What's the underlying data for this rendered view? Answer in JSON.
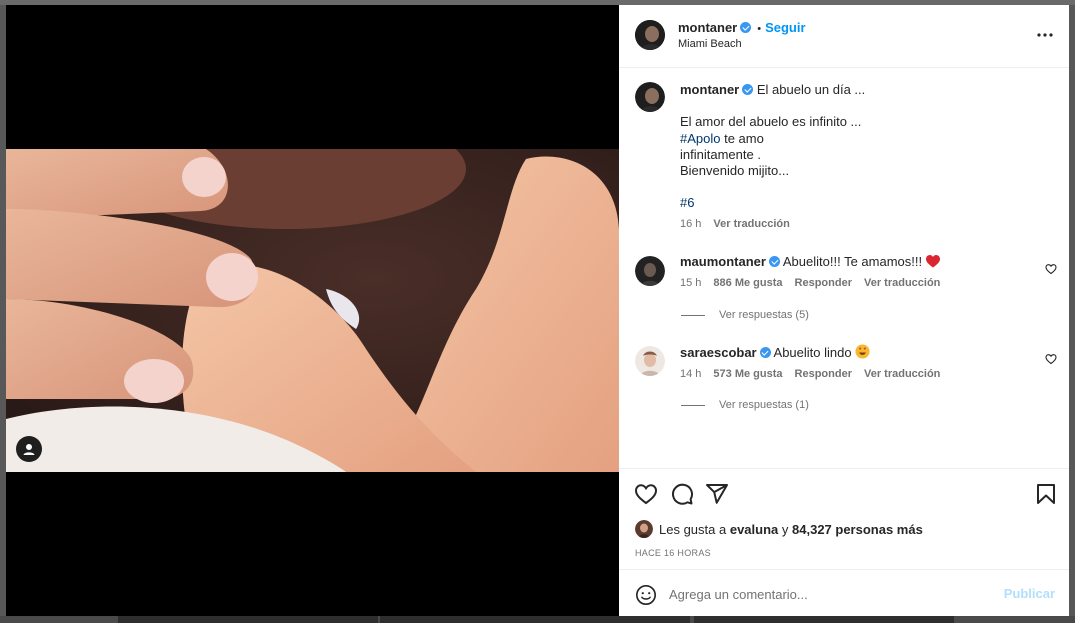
{
  "post": {
    "username": "montaner",
    "follow_label": "Seguir",
    "location": "Miami Beach",
    "dot": "•"
  },
  "caption": {
    "username": "montaner",
    "first_line": "El abuelo un día ...",
    "line2": "El amor del abuelo es infinito ...",
    "hashtag1": "#Apolo",
    "line3_rest": " te amo",
    "line4": "infinitamente .",
    "line5": "Bienvenido mijito...",
    "hashtag2": "#6",
    "time": "16 h",
    "translate": "Ver traducción"
  },
  "comments": [
    {
      "username": "maumontaner",
      "text": "Abuelito!!! Te amamos!!!",
      "emoji": "red-heart",
      "time": "15 h",
      "likes": "886 Me gusta",
      "reply": "Responder",
      "translate": "Ver traducción",
      "replies": "Ver respuestas (5)"
    },
    {
      "username": "saraescobar",
      "text": "Abuelito lindo",
      "emoji": "smiling-face-with-heart-eyes",
      "time": "14 h",
      "likes": "573 Me gusta",
      "reply": "Responder",
      "translate": "Ver traducción",
      "replies": "Ver respuestas (1)"
    }
  ],
  "likes": {
    "prefix": "Les gusta a ",
    "user": "evaluna",
    "connector": " y ",
    "count": "84,327 personas más"
  },
  "time_ago": "HACE 16 HORAS",
  "add_comment": {
    "placeholder": "Agrega un comentario...",
    "publish": "Publicar"
  },
  "icons": [
    "heart-icon",
    "comment-icon",
    "share-icon",
    "bookmark-icon",
    "more-icon",
    "emoji-icon",
    "user-tag-icon",
    "verified-icon"
  ],
  "colors": {
    "accent": "#0095f6",
    "verified": "#3897f0",
    "hashtag": "#00376b",
    "muted": "#737373",
    "publish_disabled": "#b2dffc"
  }
}
